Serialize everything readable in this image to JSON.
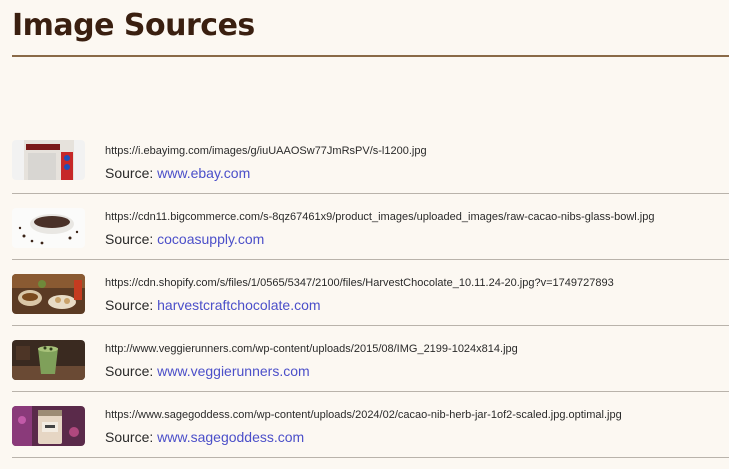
{
  "page": {
    "title": "Image Sources"
  },
  "sources": [
    {
      "url": "https://i.ebayimg.com/images/g/iuUAAOSw77JmRsPV/s-l1200.jpg",
      "source_label": "Source:",
      "source_link": "www.ebay.com",
      "thumb": "ebay-product-thumbnail"
    },
    {
      "url": "https://cdn11.bigcommerce.com/s-8qz67461x9/product_images/uploaded_images/raw-cacao-nibs-glass-bowl.jpg",
      "source_label": "Source:",
      "source_link": "cocoasupply.com",
      "thumb": "cacao-nibs-bowl-thumbnail"
    },
    {
      "url": "https://cdn.shopify.com/s/files/1/0565/5347/2100/files/HarvestChocolate_10.11.24-20.jpg?v=1749727893",
      "source_label": "Source:",
      "source_link": "harvestcraftchocolate.com",
      "thumb": "harvest-chocolate-thumbnail"
    },
    {
      "url": "http://www.veggierunners.com/wp-content/uploads/2015/08/IMG_2199-1024x814.jpg",
      "source_label": "Source:",
      "source_link": "www.veggierunners.com",
      "thumb": "green-smoothie-thumbnail"
    },
    {
      "url": "https://www.sagegoddess.com/wp-content/uploads/2024/02/cacao-nib-herb-jar-1of2-scaled.jpg.optimal.jpg",
      "source_label": "Source:",
      "source_link": "www.sagegoddess.com",
      "thumb": "herb-jar-thumbnail"
    }
  ]
}
